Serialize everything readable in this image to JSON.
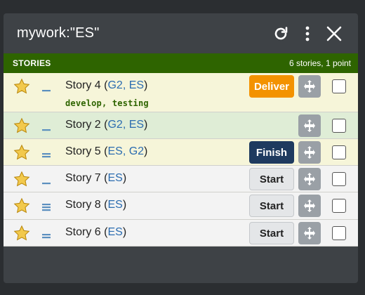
{
  "header": {
    "title": "mywork:\"ES\""
  },
  "bar": {
    "label": "STORIES",
    "summary": "6 stories, 1 point"
  },
  "rows": [
    {
      "story": "Story 4",
      "labels": "G2, ES",
      "tags": [
        "develop",
        "testing"
      ],
      "action": "Deliver",
      "bg": "#f6f5d9"
    },
    {
      "story": "Story 2",
      "labels": "G2, ES",
      "tags": [],
      "action": "",
      "bg": "#dfedd6"
    },
    {
      "story": "Story 5",
      "labels": "ES, G2",
      "tags": [],
      "action": "Finish",
      "bg": "#f6f5d9"
    },
    {
      "story": "Story 7",
      "labels": "ES",
      "tags": [],
      "action": "Start",
      "bg": "#f3f3f3"
    },
    {
      "story": "Story 8",
      "labels": "ES",
      "tags": [],
      "action": "Start",
      "bg": "#f3f3f3"
    },
    {
      "story": "Story 6",
      "labels": "ES",
      "tags": [],
      "action": "Start",
      "bg": "#f3f3f3"
    }
  ],
  "colors": {
    "header_bg": "#3e4246",
    "bar_bg": "#2e6400",
    "deliver": "#f39200",
    "finish": "#1e3a5f",
    "label_link": "#2b6cb0",
    "tag_text": "#2e6400"
  },
  "icons": {
    "refresh": "refresh-icon",
    "menu": "vertical-dots-icon",
    "close": "close-icon",
    "star": "star-icon",
    "move": "move-icon"
  },
  "estimates": [
    1,
    1,
    2,
    1,
    3,
    2
  ]
}
